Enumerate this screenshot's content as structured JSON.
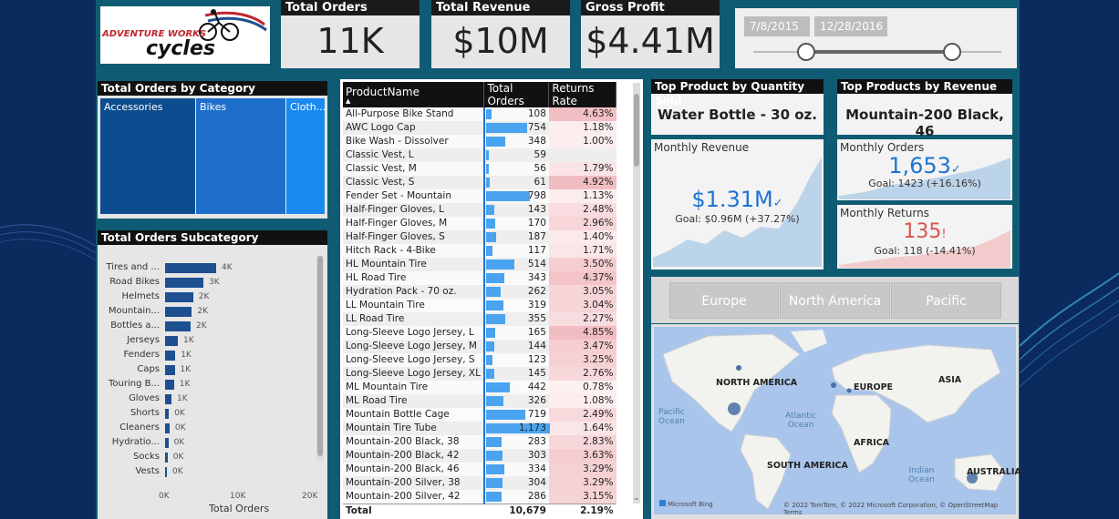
{
  "logo": {
    "line1": "ADVENTURE WORKS",
    "line2": "cycles"
  },
  "kpis": {
    "total_orders": {
      "title": "Total Orders",
      "value": "11K"
    },
    "total_revenue": {
      "title": "Total Revenue",
      "value": "$10M"
    },
    "gross_profit": {
      "title": "Gross Profit",
      "value": "$4.41M"
    }
  },
  "date_slicer": {
    "start": "7/8/2015",
    "end": "12/28/2016"
  },
  "category": {
    "title": "Total Orders by Category",
    "items": [
      {
        "label": "Accessories"
      },
      {
        "label": "Bikes"
      },
      {
        "label": "Cloth..."
      }
    ]
  },
  "subcategory": {
    "title": "Total Orders Subcategory",
    "xlabel": "Total Orders",
    "ticks": [
      "0K",
      "10K",
      "20K"
    ],
    "items": [
      {
        "label": "Tires and ...",
        "value": 4000,
        "text": "4K"
      },
      {
        "label": "Road Bikes",
        "value": 3000,
        "text": "3K"
      },
      {
        "label": "Helmets",
        "value": 2200,
        "text": "2K"
      },
      {
        "label": "Mountain...",
        "value": 2100,
        "text": "2K"
      },
      {
        "label": "Bottles a...",
        "value": 2000,
        "text": "2K"
      },
      {
        "label": "Jerseys",
        "value": 1000,
        "text": "1K"
      },
      {
        "label": "Fenders",
        "value": 800,
        "text": "1K"
      },
      {
        "label": "Caps",
        "value": 750,
        "text": "1K"
      },
      {
        "label": "Touring B...",
        "value": 700,
        "text": "1K"
      },
      {
        "label": "Gloves",
        "value": 500,
        "text": "1K"
      },
      {
        "label": "Shorts",
        "value": 300,
        "text": "0K"
      },
      {
        "label": "Cleaners",
        "value": 350,
        "text": "0K"
      },
      {
        "label": "Hydratio...",
        "value": 260,
        "text": "0K"
      },
      {
        "label": "Socks",
        "value": 200,
        "text": "0K"
      },
      {
        "label": "Vests",
        "value": 120,
        "text": "0K"
      }
    ]
  },
  "product_table": {
    "headers": [
      "ProductName",
      "Total Orders",
      "Returns Rate"
    ],
    "rows": [
      [
        "All-Purpose Bike Stand",
        "108",
        "4.63%"
      ],
      [
        "AWC Logo Cap",
        "754",
        "1.18%"
      ],
      [
        "Bike Wash - Dissolver",
        "348",
        "1.00%"
      ],
      [
        "Classic Vest, L",
        "59",
        ""
      ],
      [
        "Classic Vest, M",
        "56",
        "1.79%"
      ],
      [
        "Classic Vest, S",
        "61",
        "4.92%"
      ],
      [
        "Fender Set - Mountain",
        "798",
        "1.13%"
      ],
      [
        "Half-Finger Gloves, L",
        "143",
        "2.48%"
      ],
      [
        "Half-Finger Gloves, M",
        "170",
        "2.96%"
      ],
      [
        "Half-Finger Gloves, S",
        "187",
        "1.40%"
      ],
      [
        "Hitch Rack - 4-Bike",
        "117",
        "1.71%"
      ],
      [
        "HL Mountain Tire",
        "514",
        "3.50%"
      ],
      [
        "HL Road Tire",
        "343",
        "4.37%"
      ],
      [
        "Hydration Pack - 70 oz.",
        "262",
        "3.05%"
      ],
      [
        "LL Mountain Tire",
        "319",
        "3.04%"
      ],
      [
        "LL Road Tire",
        "355",
        "2.27%"
      ],
      [
        "Long-Sleeve Logo Jersey, L",
        "165",
        "4.85%"
      ],
      [
        "Long-Sleeve Logo Jersey, M",
        "144",
        "3.47%"
      ],
      [
        "Long-Sleeve Logo Jersey, S",
        "123",
        "3.25%"
      ],
      [
        "Long-Sleeve Logo Jersey, XL",
        "145",
        "2.76%"
      ],
      [
        "ML Mountain Tire",
        "442",
        "0.78%"
      ],
      [
        "ML Road Tire",
        "326",
        "1.08%"
      ],
      [
        "Mountain Bottle Cage",
        "719",
        "2.49%"
      ],
      [
        "Mountain Tire Tube",
        "1,173",
        "1.64%"
      ],
      [
        "Mountain-200 Black, 38",
        "283",
        "2.83%"
      ],
      [
        "Mountain-200 Black, 42",
        "303",
        "3.63%"
      ],
      [
        "Mountain-200 Black, 46",
        "334",
        "3.29%"
      ],
      [
        "Mountain-200 Silver, 38",
        "304",
        "3.29%"
      ],
      [
        "Mountain-200 Silver, 42",
        "286",
        "3.15%"
      ]
    ],
    "total": [
      "Total",
      "10,679",
      "2.19%"
    ]
  },
  "top_qty": {
    "title": "Top Product by Quantity Sold",
    "value": "Water Bottle - 30 oz."
  },
  "top_rev": {
    "title": "Top Products by Revenue",
    "value": "Mountain-200 Black, 46"
  },
  "monthly_revenue": {
    "title": "Monthly Revenue",
    "value": "$1.31M",
    "goal": "Goal: $0.96M (+37.27%)"
  },
  "monthly_orders": {
    "title": "Monthly Orders",
    "value": "1,653",
    "goal": "Goal: 1423 (+16.16%)"
  },
  "monthly_returns": {
    "title": "Monthly Returns",
    "value": "135",
    "goal": "Goal: 118 (-14.41%)"
  },
  "regions": [
    "Europe",
    "North America",
    "Pacific"
  ],
  "map": {
    "labels": [
      "NORTH AMERICA",
      "EUROPE",
      "ASIA",
      "AFRICA",
      "SOUTH AMERICA",
      "AUSTRALIA"
    ],
    "oceans": [
      "Pacific\nOcean",
      "Atlantic\nOcean",
      "Indian\nOcean"
    ],
    "brand": "Microsoft Bing",
    "copyright": "© 2022 TomTom, © 2022 Microsoft Corporation, © OpenStreetMap  Terms"
  },
  "colors": {
    "accent": "#1e73d4",
    "returns_bad": "#d9534f",
    "canvas": "#0f5b73"
  }
}
